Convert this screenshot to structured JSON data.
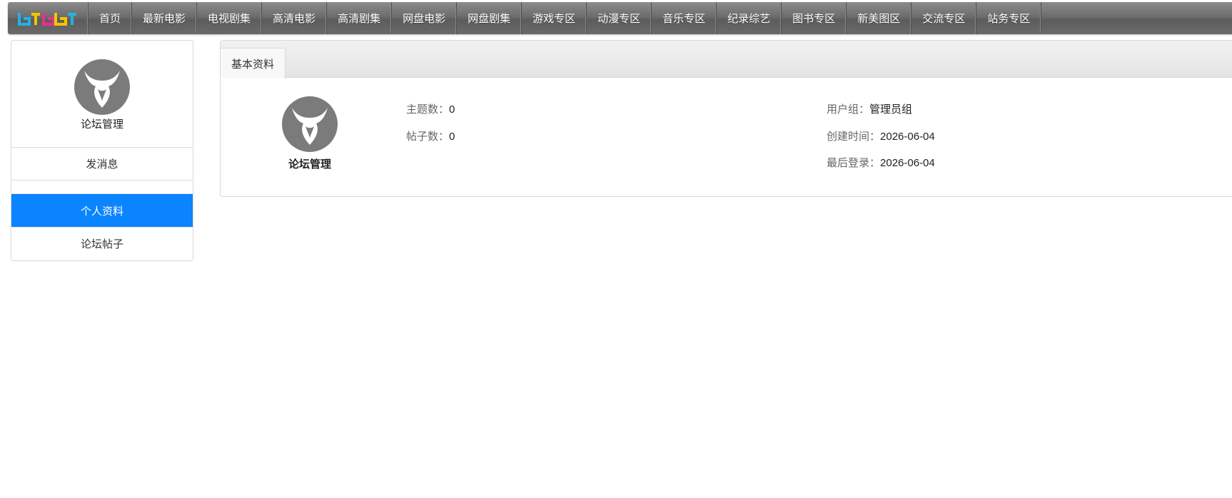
{
  "nav": {
    "logo_text": "BTBBT",
    "items": [
      "首页",
      "最新电影",
      "电视剧集",
      "高清电影",
      "高清剧集",
      "网盘电影",
      "网盘剧集",
      "游戏专区",
      "动漫专区",
      "音乐专区",
      "纪录综艺",
      "图书专区",
      "新美图区",
      "交流专区",
      "站务专区"
    ]
  },
  "sidebar": {
    "username": "论坛管理",
    "send_message": "发消息",
    "items": [
      {
        "label": "个人资料",
        "active": true
      },
      {
        "label": "论坛帖子",
        "active": false
      }
    ]
  },
  "panel": {
    "tab": "基本资料",
    "username": "论坛管理",
    "topics_label": "主题数：",
    "topics_value": "0",
    "posts_label": "帖子数：",
    "posts_value": "0",
    "group_label": "用户组：",
    "group_value": "管理员组",
    "created_label": "创建时间：",
    "created_value": "2026-06-04",
    "last_login_label": "最后登录：",
    "last_login_value": "2026-06-04"
  },
  "colors": {
    "active_item": "#0a84ff",
    "avatar": "#7b7b7b",
    "nav_bar": "#6d6d6d"
  }
}
